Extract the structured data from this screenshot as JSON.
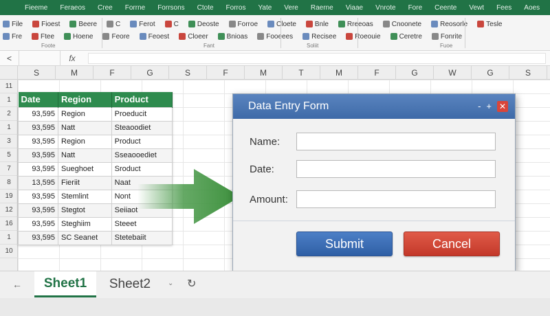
{
  "ribbon": {
    "tabs": [
      "Fieeme",
      "Feraeos",
      "Cree",
      "Forrne",
      "Forrsons",
      "Ctote",
      "Forros",
      "Yate",
      "Vere",
      "Raerne",
      "Viaae",
      "Vnrote",
      "Fore",
      "Ceente",
      "Vewt",
      "Fees",
      "Aoes"
    ],
    "row1": [
      "File",
      "Fioest",
      "Beere",
      "C",
      "Ferot",
      "C",
      "Deoste",
      "Forroe",
      "Cloete",
      "Bnle",
      "Rreeoas",
      "Cnoonete",
      "Reosorle",
      "Tesle"
    ],
    "row2": [
      "Fre",
      "Ftee",
      "Hoene",
      "Feore",
      "Feoest",
      "Cloeer",
      "Bnioas",
      "Fooeees",
      "Recisee",
      "Roeouie",
      "Ceretre",
      "Fonrite"
    ],
    "group_labels": [
      "Foote",
      "Fant",
      "Soliit",
      "Fuoe"
    ]
  },
  "formula_bar": {
    "name_box": "<",
    "fx": "fx"
  },
  "columns": [
    "S",
    "M",
    "F",
    "G",
    "S",
    "F",
    "M",
    "T",
    "M",
    "F",
    "G",
    "W",
    "G",
    "S"
  ],
  "rows": [
    "11",
    "1",
    "2",
    "1",
    "3",
    "5",
    "7",
    "8",
    "19",
    "12",
    "16",
    "1",
    "10"
  ],
  "table": {
    "headers": [
      "Date",
      "Region",
      "Product"
    ],
    "rows": [
      [
        "93,595",
        "Region",
        "Proeducit"
      ],
      [
        "93,595",
        "Natt",
        "Steaoodiet"
      ],
      [
        "93,595",
        "Region",
        "Product"
      ],
      [
        "93,595",
        "Natt",
        "Sseaooediet"
      ],
      [
        "93,595",
        "Sueghoet",
        "Sroduct"
      ],
      [
        "13,595",
        "Fieriit",
        "Naat"
      ],
      [
        "93,595",
        "Stemlint",
        "Nont"
      ],
      [
        "93,595",
        "Stegtot",
        "Seiiaot"
      ],
      [
        "93,595",
        "Steghiim",
        "Steeet"
      ],
      [
        "93,595",
        "SC Seanet",
        "Stetebaiit"
      ]
    ]
  },
  "dialog": {
    "title": "Data Entry Form",
    "fields": [
      {
        "label": "Name:",
        "value": ""
      },
      {
        "label": "Date:",
        "value": ""
      },
      {
        "label": "Amount:",
        "value": ""
      }
    ],
    "submit_label": "Submit",
    "cancel_label": "Cancel",
    "minimize": "-",
    "restore": "+",
    "close": "✕"
  },
  "sheets": {
    "nav": "←",
    "tabs": [
      "Sheet1",
      "Sheet2"
    ],
    "active": "Sheet1",
    "chevron": "⌄",
    "add": "↻"
  },
  "colors": {
    "excel_green": "#217346",
    "header_green": "#2e8b4e",
    "dialog_blue": "#3e6aa8",
    "cancel_red": "#c3382a"
  }
}
